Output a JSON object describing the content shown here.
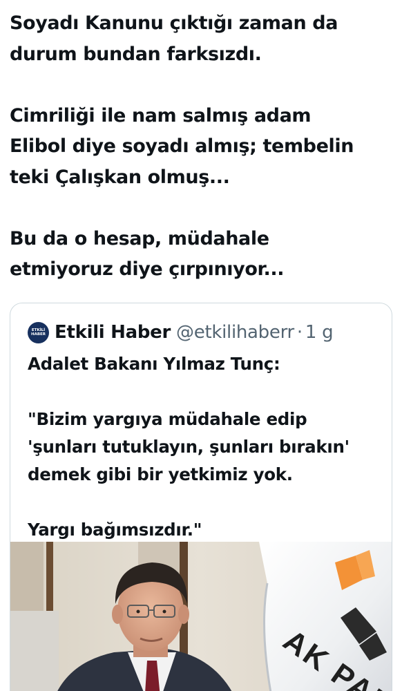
{
  "tweet": {
    "lines": [
      "Soyadı Kanunu çıktığı zaman da",
      "durum bundan farksızdı.",
      "Cimriliği ile nam salmış adam",
      "Elibol diye soyadı almış; tembelin",
      "teki Çalışkan olmuş...",
      "Bu  da o hesap, müdahale",
      "etmiyoruz diye çırpınıyor..."
    ]
  },
  "quote": {
    "avatar_text": [
      "ETKİLİ",
      "HABER"
    ],
    "author_name": "Etkili Haber",
    "handle": "@etkilihaberr",
    "separator": "·",
    "time": "1 g",
    "lines": [
      "Adalet Bakanı Yılmaz Tunç:",
      "\"Bizim yargıya müdahale edip",
      "'şunları tutuklayın, şunları bırakın'",
      "demek gibi bir yetkimiz yok.",
      "Yargı bağımsızdır.\""
    ],
    "media": {
      "flag_text": "AK PAR",
      "colors": {
        "flag_orange": "#f39237",
        "flag_gray": "#2b2b2b",
        "suit": "#2d3340",
        "tie": "#7b1d2a"
      }
    }
  }
}
